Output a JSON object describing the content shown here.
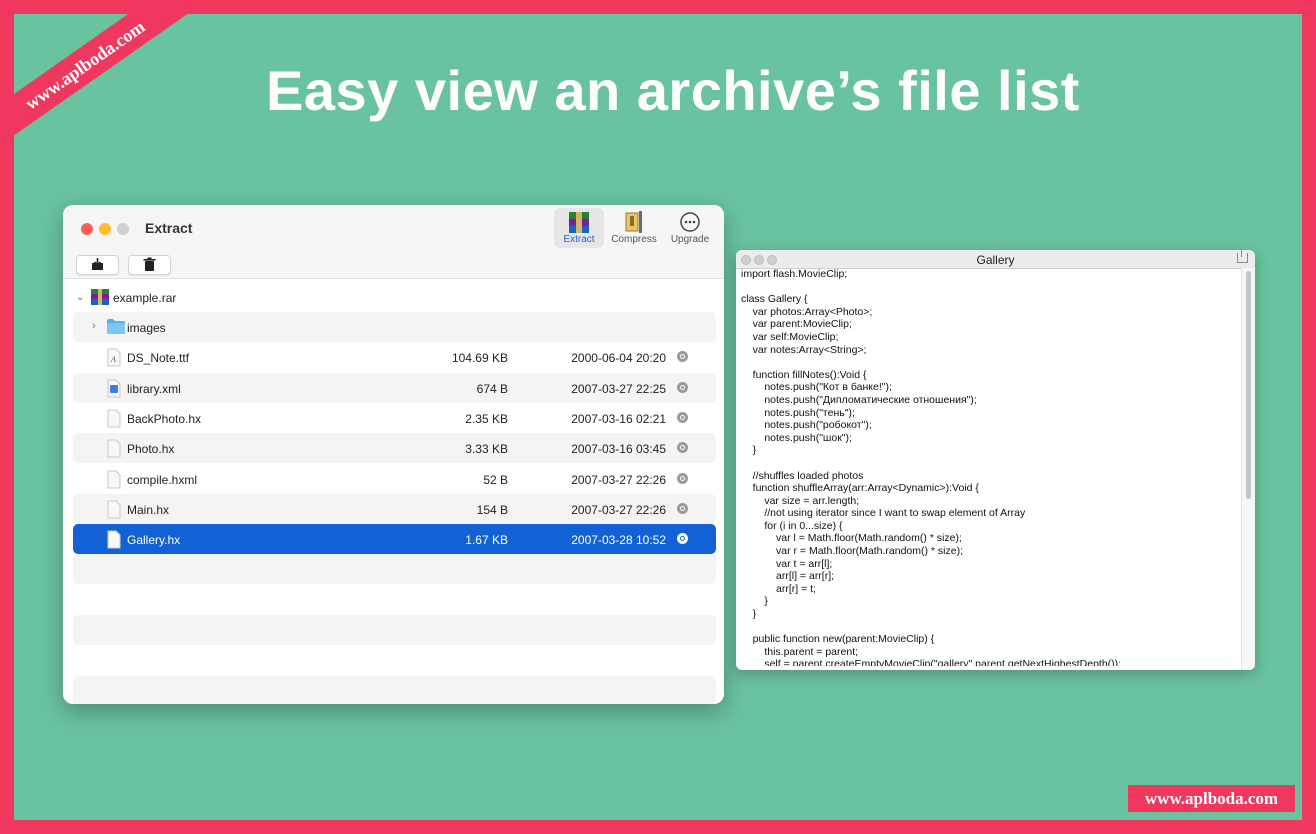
{
  "headline": "Easy view an archive’s file list",
  "watermark": {
    "ribbon": "www.aplboda.com",
    "badge": "www.aplboda.com"
  },
  "colors": {
    "border": "#f0385f",
    "background": "#6ac39f",
    "selection": "#1262d6"
  },
  "extract_window": {
    "title": "Extract",
    "toolbar": {
      "extract_label": "Extract",
      "compress_label": "Compress",
      "upgrade_label": "Upgrade"
    },
    "archive": {
      "name": "example.rar"
    },
    "rows": [
      {
        "name": "images",
        "size": "",
        "date": "",
        "type": "folder"
      },
      {
        "name": "DS_Note.ttf",
        "size": "104.69 KB",
        "date": "2000-06-04 20:20",
        "type": "font"
      },
      {
        "name": "library.xml",
        "size": "674 B",
        "date": "2007-03-27 22:25",
        "type": "xml"
      },
      {
        "name": "BackPhoto.hx",
        "size": "2.35 KB",
        "date": "2007-03-16 02:21",
        "type": "file"
      },
      {
        "name": "Photo.hx",
        "size": "3.33 KB",
        "date": "2007-03-16 03:45",
        "type": "file"
      },
      {
        "name": "compile.hxml",
        "size": "52 B",
        "date": "2007-03-27 22:26",
        "type": "file"
      },
      {
        "name": "Main.hx",
        "size": "154 B",
        "date": "2007-03-27 22:26",
        "type": "file"
      },
      {
        "name": "Gallery.hx",
        "size": "1.67 KB",
        "date": "2007-03-28 10:52",
        "type": "file",
        "selected": true
      }
    ]
  },
  "gallery_window": {
    "title": "Gallery",
    "code": "import flash.MovieClip;\n\nclass Gallery {\n    var photos:Array<Photo>;\n    var parent:MovieClip;\n    var self:MovieClip;\n    var notes:Array<String>;\n\n    function fillNotes():Void {\n        notes.push(\"Кот в банке!\");\n        notes.push(\"Дипломатические отношения\");\n        notes.push(\"тень\");\n        notes.push(\"робокот\");\n        notes.push(\"шок\");\n    }\n\n    //shuffles loaded photos\n    function shuffleArray(arr:Array<Dynamic>):Void {\n        var size = arr.length;\n        //not using iterator since I want to swap element of Array\n        for (i in 0...size) {\n            var l = Math.floor(Math.random() * size);\n            var r = Math.floor(Math.random() * size);\n            var t = arr[l];\n            arr[l] = arr[r];\n            arr[r] = t;\n        }\n    }\n\n    public function new(parent:MovieClip) {\n        this.parent = parent;\n        self = parent.createEmptyMovieClip(\"gallery\",parent.getNextHighestDepth());"
  }
}
